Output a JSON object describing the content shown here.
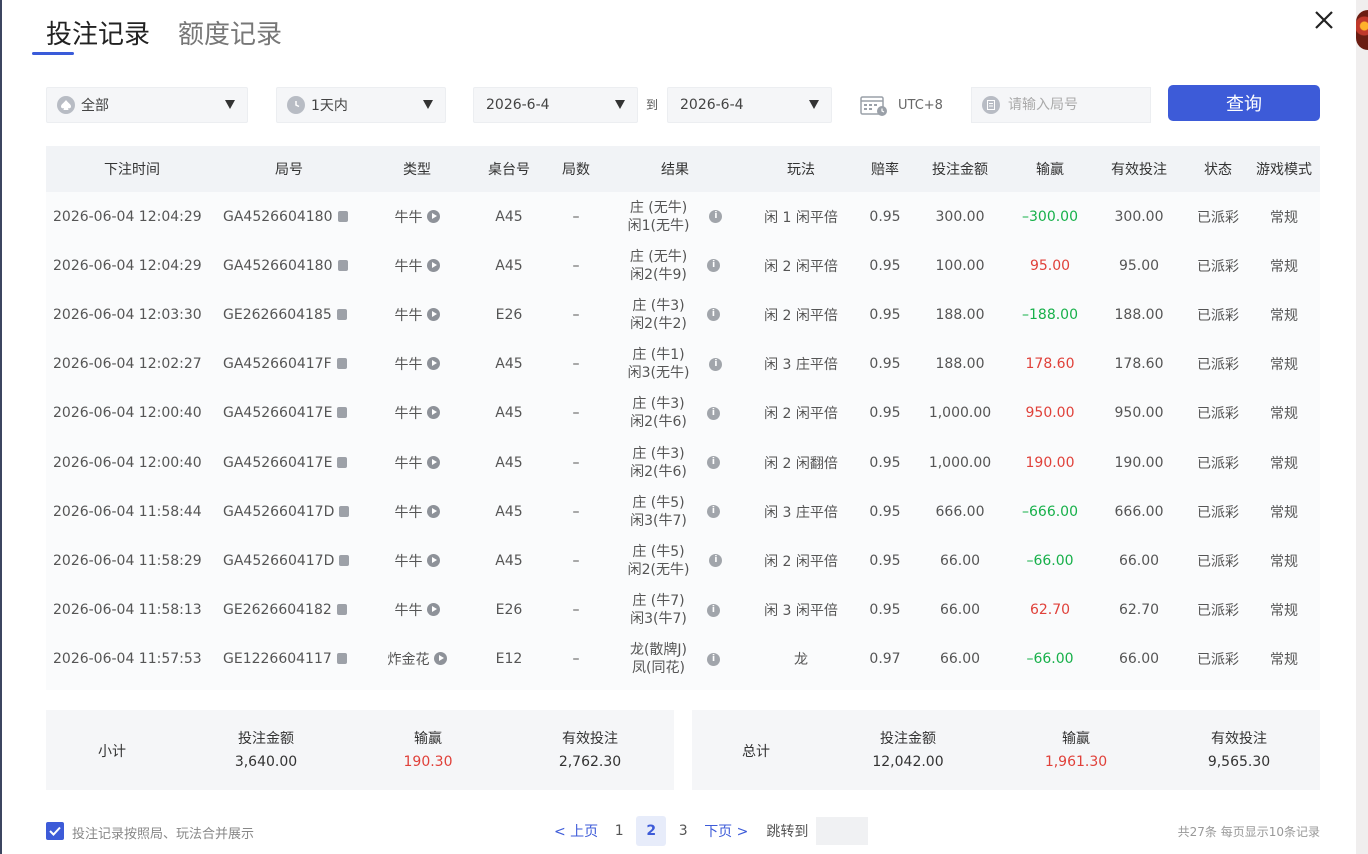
{
  "tabs": [
    {
      "label": "投注记录"
    },
    {
      "label": "额度记录"
    }
  ],
  "filters": {
    "game": "全部",
    "period": "1天内",
    "date_from": "2026-6-4",
    "to_label": "到",
    "date_to": "2026-6-4",
    "timezone": "UTC+8",
    "round_placeholder": "请输入局号",
    "query_label": "查询"
  },
  "table": {
    "headers": [
      "下注时间",
      "局号",
      "类型",
      "桌台号",
      "局数",
      "结果",
      "玩法",
      "赔率",
      "投注金额",
      "输赢",
      "有效投注",
      "状态",
      "游戏模式"
    ],
    "rows": [
      {
        "time": "2026-06-04 12:04:29",
        "round": "GA4526604180",
        "type": "牛牛",
        "table": "A45",
        "count": "–",
        "result1": "庄 (无牛)",
        "result2": "闲1(无牛)",
        "play": "闲 1 闲平倍",
        "odds": "0.95",
        "bet": "300.00",
        "win": "–300.00",
        "win_status": "lose",
        "valid": "300.00",
        "status": "已派彩",
        "mode": "常规"
      },
      {
        "time": "2026-06-04 12:04:29",
        "round": "GA4526604180",
        "type": "牛牛",
        "table": "A45",
        "count": "–",
        "result1": "庄 (无牛)",
        "result2": "闲2(牛9)",
        "play": "闲 2 闲平倍",
        "odds": "0.95",
        "bet": "100.00",
        "win": "95.00",
        "win_status": "win",
        "valid": "95.00",
        "status": "已派彩",
        "mode": "常规"
      },
      {
        "time": "2026-06-04 12:03:30",
        "round": "GE2626604185",
        "type": "牛牛",
        "table": "E26",
        "count": "–",
        "result1": "庄 (牛3)",
        "result2": "闲2(牛2)",
        "play": "闲 2 闲平倍",
        "odds": "0.95",
        "bet": "188.00",
        "win": "–188.00",
        "win_status": "lose",
        "valid": "188.00",
        "status": "已派彩",
        "mode": "常规"
      },
      {
        "time": "2026-06-04 12:02:27",
        "round": "GA452660417F",
        "type": "牛牛",
        "table": "A45",
        "count": "–",
        "result1": "庄 (牛1)",
        "result2": "闲3(无牛)",
        "play": "闲 3 庄平倍",
        "odds": "0.95",
        "bet": "188.00",
        "win": "178.60",
        "win_status": "win",
        "valid": "178.60",
        "status": "已派彩",
        "mode": "常规"
      },
      {
        "time": "2026-06-04 12:00:40",
        "round": "GA452660417E",
        "type": "牛牛",
        "table": "A45",
        "count": "–",
        "result1": "庄 (牛3)",
        "result2": "闲2(牛6)",
        "play": "闲 2 闲平倍",
        "odds": "0.95",
        "bet": "1,000.00",
        "win": "950.00",
        "win_status": "win",
        "valid": "950.00",
        "status": "已派彩",
        "mode": "常规"
      },
      {
        "time": "2026-06-04 12:00:40",
        "round": "GA452660417E",
        "type": "牛牛",
        "table": "A45",
        "count": "–",
        "result1": "庄 (牛3)",
        "result2": "闲2(牛6)",
        "play": "闲 2 闲翻倍",
        "odds": "0.95",
        "bet": "1,000.00",
        "win": "190.00",
        "win_status": "win",
        "valid": "190.00",
        "status": "已派彩",
        "mode": "常规"
      },
      {
        "time": "2026-06-04 11:58:44",
        "round": "GA452660417D",
        "type": "牛牛",
        "table": "A45",
        "count": "–",
        "result1": "庄 (牛5)",
        "result2": "闲3(牛7)",
        "play": "闲 3 庄平倍",
        "odds": "0.95",
        "bet": "666.00",
        "win": "–666.00",
        "win_status": "lose",
        "valid": "666.00",
        "status": "已派彩",
        "mode": "常规"
      },
      {
        "time": "2026-06-04 11:58:29",
        "round": "GA452660417D",
        "type": "牛牛",
        "table": "A45",
        "count": "–",
        "result1": "庄 (牛5)",
        "result2": "闲2(无牛)",
        "play": "闲 2 闲平倍",
        "odds": "0.95",
        "bet": "66.00",
        "win": "–66.00",
        "win_status": "lose",
        "valid": "66.00",
        "status": "已派彩",
        "mode": "常规"
      },
      {
        "time": "2026-06-04 11:58:13",
        "round": "GE2626604182",
        "type": "牛牛",
        "table": "E26",
        "count": "–",
        "result1": "庄 (牛7)",
        "result2": "闲3(牛7)",
        "play": "闲 3 闲平倍",
        "odds": "0.95",
        "bet": "66.00",
        "win": "62.70",
        "win_status": "win",
        "valid": "62.70",
        "status": "已派彩",
        "mode": "常规"
      },
      {
        "time": "2026-06-04 11:57:53",
        "round": "GE1226604117",
        "type": "炸金花",
        "table": "E12",
        "count": "–",
        "result1": "龙(散牌J)",
        "result2": "凤(同花)",
        "play": "龙",
        "odds": "0.97",
        "bet": "66.00",
        "win": "–66.00",
        "win_status": "lose",
        "valid": "66.00",
        "status": "已派彩",
        "mode": "常规"
      }
    ]
  },
  "subtotal": {
    "label": "小计",
    "bet_label": "投注金额",
    "bet": "3,640.00",
    "win_label": "输赢",
    "win": "190.30",
    "valid_label": "有效投注",
    "valid": "2,762.30"
  },
  "total": {
    "label": "总计",
    "bet_label": "投注金额",
    "bet": "12,042.00",
    "win_label": "输赢",
    "win": "1,961.30",
    "valid_label": "有效投注",
    "valid": "9,565.30"
  },
  "footer": {
    "merge_label": "投注记录按照局、玩法合并展示",
    "prev": "< 上页",
    "pages": [
      "1",
      "2",
      "3"
    ],
    "current_page": "2",
    "next": "下页 >",
    "jump_label": "跳转到",
    "info": "共27条   每页显示10条记录"
  },
  "colors": {
    "accent": "#3d5bd8",
    "win": "#e0413a",
    "lose": "#17b04a"
  }
}
